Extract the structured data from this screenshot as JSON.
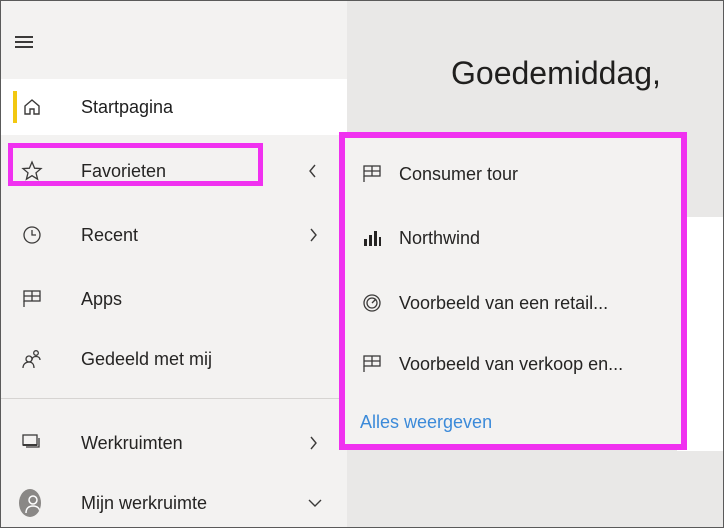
{
  "main": {
    "greeting": "Goedemiddag,"
  },
  "sidebar": {
    "items": [
      {
        "label": "Startpagina",
        "icon": "home-icon",
        "selected": true
      },
      {
        "label": "Favorieten",
        "icon": "star-icon",
        "chevron": "chevron-left-icon",
        "highlighted": true
      },
      {
        "label": "Recent",
        "icon": "clock-icon",
        "chevron": "chevron-right-icon"
      },
      {
        "label": "Apps",
        "icon": "apps-icon"
      },
      {
        "label": "Gedeeld met mij",
        "icon": "shared-people-icon"
      },
      {
        "label": "Werkruimten",
        "icon": "workspaces-icon",
        "chevron": "chevron-right-icon"
      },
      {
        "label": "Mijn werkruimte",
        "icon": "avatar-icon",
        "chevron": "chevron-down-icon"
      }
    ]
  },
  "flyout": {
    "items": [
      {
        "label": "Consumer tour",
        "icon": "app-grid-icon"
      },
      {
        "label": "Northwind",
        "icon": "bar-chart-icon"
      },
      {
        "label": "Voorbeeld van een retail...",
        "icon": "dashboard-gauge-icon"
      },
      {
        "label": "Voorbeeld van verkoop en...",
        "icon": "app-grid-icon"
      }
    ],
    "see_all": "Alles weergeven"
  },
  "colors": {
    "accent_yellow": "#f2c811",
    "highlight_magenta": "#f031f0",
    "link_blue": "#3b8ad9",
    "sidebar_bg": "#f3f2f1",
    "main_bg": "#e9e8e7"
  }
}
